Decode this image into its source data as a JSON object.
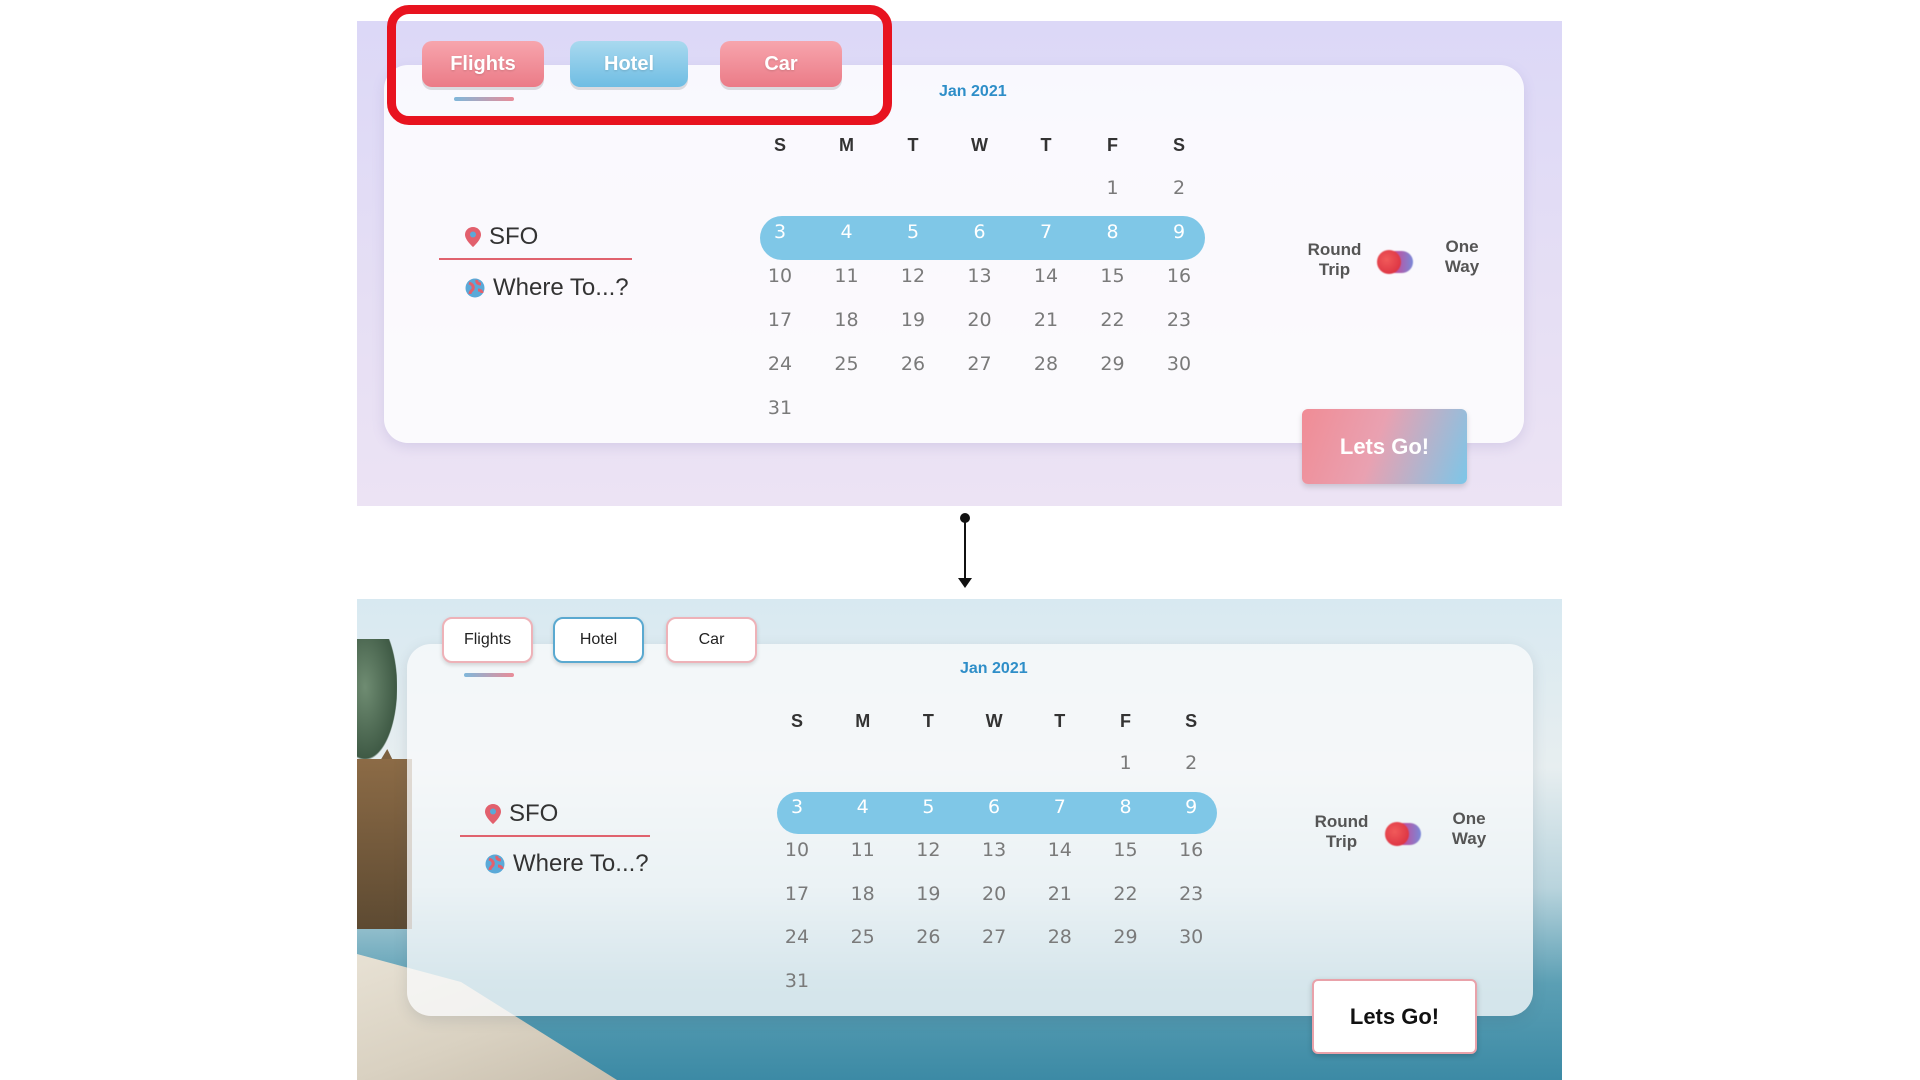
{
  "tabs": [
    {
      "label": "Flights"
    },
    {
      "label": "Hotel"
    },
    {
      "label": "Car"
    }
  ],
  "calendar": {
    "month": "Jan 2021",
    "weekdays": [
      "S",
      "M",
      "T",
      "W",
      "T",
      "F",
      "S"
    ],
    "weeks": [
      [
        "",
        "",
        "",
        "",
        "",
        "1",
        "2"
      ],
      [
        "3",
        "4",
        "5",
        "6",
        "7",
        "8",
        "9"
      ],
      [
        "10",
        "11",
        "12",
        "13",
        "14",
        "15",
        "16"
      ],
      [
        "17",
        "18",
        "19",
        "20",
        "21",
        "22",
        "23"
      ],
      [
        "24",
        "25",
        "26",
        "27",
        "28",
        "29",
        "30"
      ],
      [
        "31",
        "",
        "",
        "",
        "",
        "",
        ""
      ]
    ],
    "selected_week_index": 1
  },
  "origin": {
    "value": "SFO",
    "icon": "location-pin-icon"
  },
  "destination": {
    "placeholder": "Where To...?",
    "icon": "globe-icon"
  },
  "trip_type": {
    "left_label": "Round Trip",
    "right_label": "One Way"
  },
  "cta": {
    "label": "Lets Go!"
  },
  "colors": {
    "pink": "#eb7b87",
    "blue": "#6fbde3",
    "highlight_red": "#e8131f",
    "selected_week": "#7fc7e7",
    "month_text": "#2e8ec8"
  }
}
